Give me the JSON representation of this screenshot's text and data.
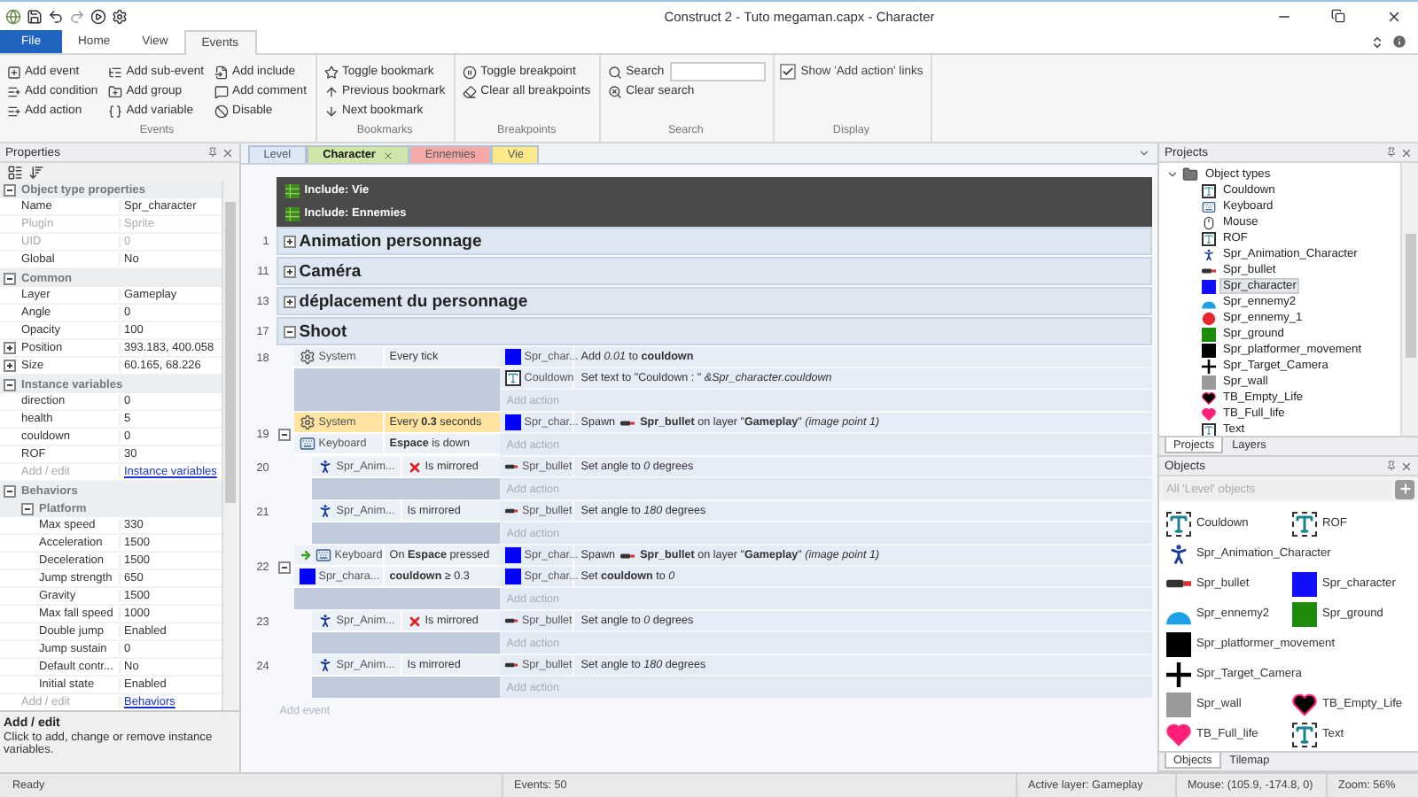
{
  "window": {
    "title": "Construct 2 - Tuto megaman.capx - Character"
  },
  "ribbon": {
    "tabs": [
      {
        "label": "File",
        "kind": "file",
        "selected": false
      },
      {
        "label": "Home",
        "kind": "tab",
        "selected": false
      },
      {
        "label": "View",
        "kind": "tab",
        "selected": false
      },
      {
        "label": "Events",
        "kind": "tab",
        "selected": true
      }
    ],
    "groups": [
      {
        "label": "Events",
        "kind": "events",
        "items": [
          {
            "kind": "button",
            "label": "Add event"
          },
          {
            "kind": "button",
            "label": "Add condition"
          },
          {
            "kind": "button",
            "label": "Add action"
          },
          {
            "kind": "button",
            "label": "Add sub-event"
          },
          {
            "kind": "button",
            "label": "Add group"
          },
          {
            "kind": "button",
            "label": "Add variable"
          },
          {
            "kind": "button",
            "label": "Add include"
          },
          {
            "kind": "button",
            "label": "Add comment"
          },
          {
            "kind": "button",
            "label": "Disable"
          }
        ]
      },
      {
        "label": "Bookmarks",
        "kind": "bookmarks",
        "items": [
          {
            "kind": "button",
            "label": "Toggle bookmark"
          },
          {
            "kind": "button",
            "label": "Previous bookmark"
          },
          {
            "kind": "button",
            "label": "Next bookmark"
          }
        ]
      },
      {
        "label": "Breakpoints",
        "kind": "breakpoints",
        "items": [
          {
            "kind": "button",
            "label": "Toggle breakpoint"
          },
          {
            "kind": "button",
            "label": "Clear all breakpoints"
          }
        ]
      },
      {
        "label": "Search",
        "kind": "search",
        "items": [
          {
            "kind": "search",
            "label": "Search"
          },
          {
            "kind": "button",
            "label": "Clear search"
          }
        ]
      },
      {
        "label": "Display",
        "kind": "display",
        "items": [
          {
            "kind": "checkbox",
            "label": "Show 'Add action' links",
            "checked": true
          }
        ]
      }
    ]
  },
  "properties": {
    "title": "Properties",
    "sections": [
      {
        "title": "Object type properties",
        "expanded": true,
        "rows": [
          {
            "kind": "prop",
            "name": "Name",
            "value": "Spr_character",
            "disabled": false,
            "expandable": false
          },
          {
            "kind": "prop",
            "name": "Plugin",
            "value": "Sprite",
            "disabled": true,
            "expandable": false
          },
          {
            "kind": "prop",
            "name": "UID",
            "value": "0",
            "disabled": true,
            "expandable": false
          },
          {
            "kind": "prop",
            "name": "Global",
            "value": "No",
            "disabled": false,
            "expandable": false
          }
        ]
      },
      {
        "title": "Common",
        "expanded": true,
        "rows": [
          {
            "kind": "prop",
            "name": "Layer",
            "value": "Gameplay",
            "disabled": false,
            "expandable": false
          },
          {
            "kind": "prop",
            "name": "Angle",
            "value": "0",
            "disabled": false,
            "expandable": false
          },
          {
            "kind": "prop",
            "name": "Opacity",
            "value": "100",
            "disabled": false,
            "expandable": false
          },
          {
            "kind": "prop",
            "name": "Position",
            "value": "393.183, 400.058",
            "disabled": false,
            "expandable": true
          },
          {
            "kind": "prop",
            "name": "Size",
            "value": "60.165, 68.226",
            "disabled": false,
            "expandable": true
          }
        ]
      },
      {
        "title": "Instance variables",
        "expanded": true,
        "rows": [
          {
            "kind": "prop",
            "name": "direction",
            "value": "0",
            "disabled": false,
            "expandable": false
          },
          {
            "kind": "prop",
            "name": "health",
            "value": "5",
            "disabled": false,
            "expandable": false
          },
          {
            "kind": "prop",
            "name": "couldown",
            "value": "0",
            "disabled": false,
            "expandable": false
          },
          {
            "kind": "prop",
            "name": "ROF",
            "value": "30",
            "disabled": false,
            "expandable": false
          },
          {
            "kind": "link",
            "name": "Add / edit",
            "value": "Instance variables"
          }
        ]
      },
      {
        "title": "Behaviors",
        "expanded": true,
        "rows": [
          {
            "kind": "group",
            "title": "Platform",
            "expanded": true,
            "rows": [
              {
                "kind": "prop",
                "name": "Max speed",
                "value": "330",
                "disabled": false,
                "expandable": false
              },
              {
                "kind": "prop",
                "name": "Acceleration",
                "value": "1500",
                "disabled": false,
                "expandable": false
              },
              {
                "kind": "prop",
                "name": "Deceleration",
                "value": "1500",
                "disabled": false,
                "expandable": false
              },
              {
                "kind": "prop",
                "name": "Jump strength",
                "value": "650",
                "disabled": false,
                "expandable": false
              },
              {
                "kind": "prop",
                "name": "Gravity",
                "value": "1500",
                "disabled": false,
                "expandable": false
              },
              {
                "kind": "prop",
                "name": "Max fall speed",
                "value": "1000",
                "disabled": false,
                "expandable": false
              },
              {
                "kind": "prop",
                "name": "Double jump",
                "value": "Enabled",
                "disabled": false,
                "expandable": false
              },
              {
                "kind": "prop",
                "name": "Jump sustain",
                "value": "0",
                "disabled": false,
                "expandable": false
              },
              {
                "kind": "prop",
                "name": "Default contr...",
                "value": "No",
                "disabled": false,
                "expandable": false
              },
              {
                "kind": "prop",
                "name": "Initial state",
                "value": "Enabled",
                "disabled": false,
                "expandable": false
              }
            ]
          },
          {
            "kind": "link",
            "name": "Add / edit",
            "value": "Behaviors"
          }
        ]
      }
    ],
    "description": {
      "title": "Add / edit",
      "text": "Click to add, change or remove instance variables."
    }
  },
  "sheet": {
    "tabs": [
      {
        "label": "Level",
        "color": "#dce8f8",
        "selected": false,
        "closable": false
      },
      {
        "label": "Character",
        "color": "#cfe6a8",
        "selected": true,
        "closable": true
      },
      {
        "label": "Ennemies",
        "color": "#f4a8a8",
        "selected": false,
        "closable": false
      },
      {
        "label": "Vie",
        "color": "#fbe98a",
        "selected": false,
        "closable": false
      }
    ],
    "includes": [
      "Include: Vie",
      "Include: Ennemies"
    ],
    "groups": [
      {
        "number": "1",
        "title": "Animation personnage",
        "expanded": false
      },
      {
        "number": "11",
        "title": "Caméra",
        "expanded": false
      },
      {
        "number": "13",
        "title": "déplacement du personnage",
        "expanded": false
      },
      {
        "number": "17",
        "title": "Shoot",
        "expanded": true,
        "events": [
          {
            "number": "18",
            "conditions": [
              {
                "object": "System",
                "kind": "system",
                "text": "Every tick",
                "selected": false,
                "inverted": false,
                "trigger": false
              }
            ],
            "actions": [
              {
                "object": "Spr_char...",
                "kind": "sprite",
                "color": "#0000ff",
                "text": "Add *0.01* to **couldown**"
              },
              {
                "object": "Couldown",
                "kind": "text",
                "text": "Set text to \"Couldown : \" *&Spr_character.couldown*"
              }
            ],
            "add_action": "Add action"
          },
          {
            "number": "19",
            "expanded": true,
            "conditions": [
              {
                "object": "System",
                "kind": "system",
                "text": "Every **0.3** seconds",
                "selected": true,
                "inverted": false,
                "trigger": false
              },
              {
                "object": "Keyboard",
                "kind": "keyboard",
                "text": "**Espace** is down",
                "selected": false,
                "inverted": false,
                "trigger": false
              }
            ],
            "actions": [
              {
                "object": "Spr_char...",
                "kind": "sprite",
                "color": "#0000ff",
                "text": "Spawn",
                "param": "**Spr_bullet** on layer \"**Gameplay**\" *(image point 1)*"
              }
            ],
            "add_action": "Add action",
            "children": [
              {
                "number": "20",
                "conditions": [
                  {
                    "object": "Spr_Anim...",
                    "kind": "animation",
                    "text": "Is mirrored",
                    "selected": false,
                    "inverted": true,
                    "trigger": false
                  }
                ],
                "actions": [
                  {
                    "object": "Spr_bullet",
                    "kind": "bullet",
                    "text": "Set angle to *0* degrees"
                  }
                ],
                "add_action": "Add action"
              },
              {
                "number": "21",
                "conditions": [
                  {
                    "object": "Spr_Anim...",
                    "kind": "animation",
                    "text": "Is mirrored",
                    "selected": false,
                    "inverted": false,
                    "trigger": false
                  }
                ],
                "actions": [
                  {
                    "object": "Spr_bullet",
                    "kind": "bullet",
                    "text": "Set angle to *180* degrees"
                  }
                ],
                "add_action": "Add action"
              }
            ]
          },
          {
            "number": "22",
            "expanded": true,
            "conditions": [
              {
                "object": "Keyboard",
                "kind": "keyboard",
                "text": "On **Espace** pressed",
                "selected": false,
                "inverted": false,
                "trigger": true
              },
              {
                "object": "Spr_chara...",
                "kind": "sprite",
                "color": "#0000ff",
                "text": "**couldown** ≥ 0.3",
                "selected": false,
                "inverted": false,
                "trigger": false
              }
            ],
            "actions": [
              {
                "object": "Spr_char...",
                "kind": "sprite",
                "color": "#0000ff",
                "text": "Spawn",
                "param": "**Spr_bullet** on layer \"**Gameplay**\" *(image point 1)*"
              },
              {
                "object": "Spr_char...",
                "kind": "sprite",
                "color": "#0000ff",
                "text": "Set **couldown** to *0*"
              }
            ],
            "add_action": "Add action",
            "children": [
              {
                "number": "23",
                "conditions": [
                  {
                    "object": "Spr_Anim...",
                    "kind": "animation",
                    "text": "Is mirrored",
                    "selected": false,
                    "inverted": true,
                    "trigger": false
                  }
                ],
                "actions": [
                  {
                    "object": "Spr_bullet",
                    "kind": "bullet",
                    "text": "Set angle to *0* degrees"
                  }
                ],
                "add_action": "Add action"
              },
              {
                "number": "24",
                "conditions": [
                  {
                    "object": "Spr_Anim...",
                    "kind": "animation",
                    "text": "Is mirrored",
                    "selected": false,
                    "inverted": false,
                    "trigger": false
                  }
                ],
                "actions": [
                  {
                    "object": "Spr_bullet",
                    "kind": "bullet",
                    "text": "Set angle to *180* degrees"
                  }
                ],
                "add_action": "Add action"
              }
            ]
          }
        ]
      }
    ],
    "add_event": "Add event"
  },
  "projects": {
    "title": "Projects",
    "tree": [
      {
        "label": "Object types",
        "expanded": true,
        "children": [
          {
            "label": "Couldown",
            "kind": "text",
            "selected": false
          },
          {
            "label": "Keyboard",
            "kind": "keyboard",
            "selected": false
          },
          {
            "label": "Mouse",
            "kind": "mouse",
            "selected": false
          },
          {
            "label": "ROF",
            "kind": "text",
            "selected": false
          },
          {
            "label": "Spr_Animation_Character",
            "kind": "animation",
            "selected": false
          },
          {
            "label": "Spr_bullet",
            "kind": "bullet",
            "selected": false
          },
          {
            "label": "Spr_character",
            "kind": "sprite",
            "color": "#1010ff",
            "selected": true
          },
          {
            "label": "Spr_ennemy2",
            "kind": "enemy",
            "color": "#1ea0e6",
            "selected": false
          },
          {
            "label": "Spr_ennemy_1",
            "kind": "ball",
            "color": "#e8262b",
            "selected": false
          },
          {
            "label": "Spr_ground",
            "kind": "sprite",
            "color": "#1e8c0a",
            "selected": false
          },
          {
            "label": "Spr_platformer_movement",
            "kind": "sprite",
            "color": "#000000",
            "selected": false
          },
          {
            "label": "Spr_Target_Camera",
            "kind": "cross",
            "selected": false
          },
          {
            "label": "Spr_wall",
            "kind": "sprite",
            "color": "#9a9a9a",
            "selected": false
          },
          {
            "label": "TB_Empty_Life",
            "kind": "heart",
            "color": "#000000",
            "selected": false
          },
          {
            "label": "TB_Full_life",
            "kind": "heart",
            "color": "#ff1e78",
            "selected": false
          },
          {
            "label": "Text",
            "kind": "text",
            "selected": false
          }
        ]
      }
    ],
    "tabs": [
      {
        "label": "Projects",
        "selected": true
      },
      {
        "label": "Layers",
        "selected": false
      }
    ]
  },
  "objects": {
    "title": "Objects",
    "filter": {
      "placeholder": "All 'Level' objects"
    },
    "items": [
      {
        "label": "Couldown",
        "kind": "text"
      },
      {
        "label": "ROF",
        "kind": "text"
      },
      {
        "label": "Spr_Animation_Character",
        "kind": "animation"
      },
      {
        "label": "Spr_bullet",
        "kind": "bullet"
      },
      {
        "label": "Spr_character",
        "kind": "sprite",
        "color": "#1010ff"
      },
      {
        "label": "Spr_ennemy2",
        "kind": "enemy",
        "color": "#1ea0e6"
      },
      {
        "label": "Spr_ground",
        "kind": "sprite",
        "color": "#1e8c0a"
      },
      {
        "label": "Spr_platformer_movement",
        "kind": "sprite",
        "color": "#000000"
      },
      {
        "label": "Spr_Target_Camera",
        "kind": "cross"
      },
      {
        "label": "Spr_wall",
        "kind": "sprite",
        "color": "#9a9a9a"
      },
      {
        "label": "TB_Empty_Life",
        "kind": "heart",
        "color": "#000000"
      },
      {
        "label": "TB_Full_life",
        "kind": "heart",
        "color": "#ff1e78"
      },
      {
        "label": "Text",
        "kind": "text"
      }
    ],
    "tabs": [
      {
        "label": "Objects",
        "selected": true
      },
      {
        "label": "Tilemap",
        "selected": false
      }
    ]
  },
  "status_bar": [
    "Ready",
    "Events: 50",
    "Active layer: Gameplay",
    "Mouse: (105.9, -174.8, 0)",
    "Zoom: 56%"
  ]
}
